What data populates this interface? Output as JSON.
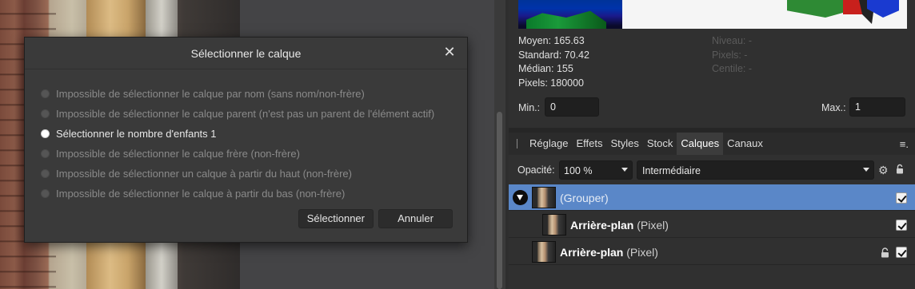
{
  "dialog": {
    "title": "Sélectionner le calque",
    "options": [
      {
        "label": "Impossible de sélectionner le calque par nom (sans nom/non-frère)",
        "active": false
      },
      {
        "label": "Impossible de sélectionner le calque parent (n'est pas un parent de l'élément actif)",
        "active": false
      },
      {
        "label": "Sélectionner le nombre d'enfants 1",
        "active": true
      },
      {
        "label": "Impossible de sélectionner le calque frère (non-frère)",
        "active": false
      },
      {
        "label": "Impossible de sélectionner un calque à partir du haut (non-frère)",
        "active": false
      },
      {
        "label": "Impossible de sélectionner le calque à partir du bas (non-frère)",
        "active": false
      }
    ],
    "select_label": "Sélectionner",
    "cancel_label": "Annuler"
  },
  "histogram": {
    "stats": {
      "moyen": "Moyen: 165.63",
      "standard": "Standard: 70.42",
      "median": "Médian: 155",
      "pixels": "Pixels: 180000"
    },
    "stats_right": {
      "niveau": "Niveau: -",
      "pixels": "Pixels: -",
      "centile": "Centile: -"
    },
    "min_label": "Min.:",
    "min_value": "0",
    "max_label": "Max.:",
    "max_value": "1"
  },
  "tabs": [
    {
      "label": "Réglage",
      "active": false
    },
    {
      "label": "Effets",
      "active": false
    },
    {
      "label": "Styles",
      "active": false
    },
    {
      "label": "Stock",
      "active": false
    },
    {
      "label": "Calques",
      "active": true
    },
    {
      "label": "Canaux",
      "active": false
    }
  ],
  "tab_menu_icon": "≡.",
  "layers_panel": {
    "opacity_label": "Opacité:",
    "opacity_value": "100 %",
    "blend_mode": "Intermédiaire",
    "layers": [
      {
        "name": "(Grouper)",
        "type": "",
        "selected": true
      },
      {
        "name": "Arrière-plan",
        "type": "(Pixel)",
        "selected": false
      },
      {
        "name": "Arrière-plan",
        "type": "(Pixel)",
        "selected": false,
        "locked": true
      }
    ]
  },
  "colors": {
    "selection": "#5a87c8",
    "panel_bg": "#303030",
    "dialog_bg": "#3a3a3a"
  }
}
